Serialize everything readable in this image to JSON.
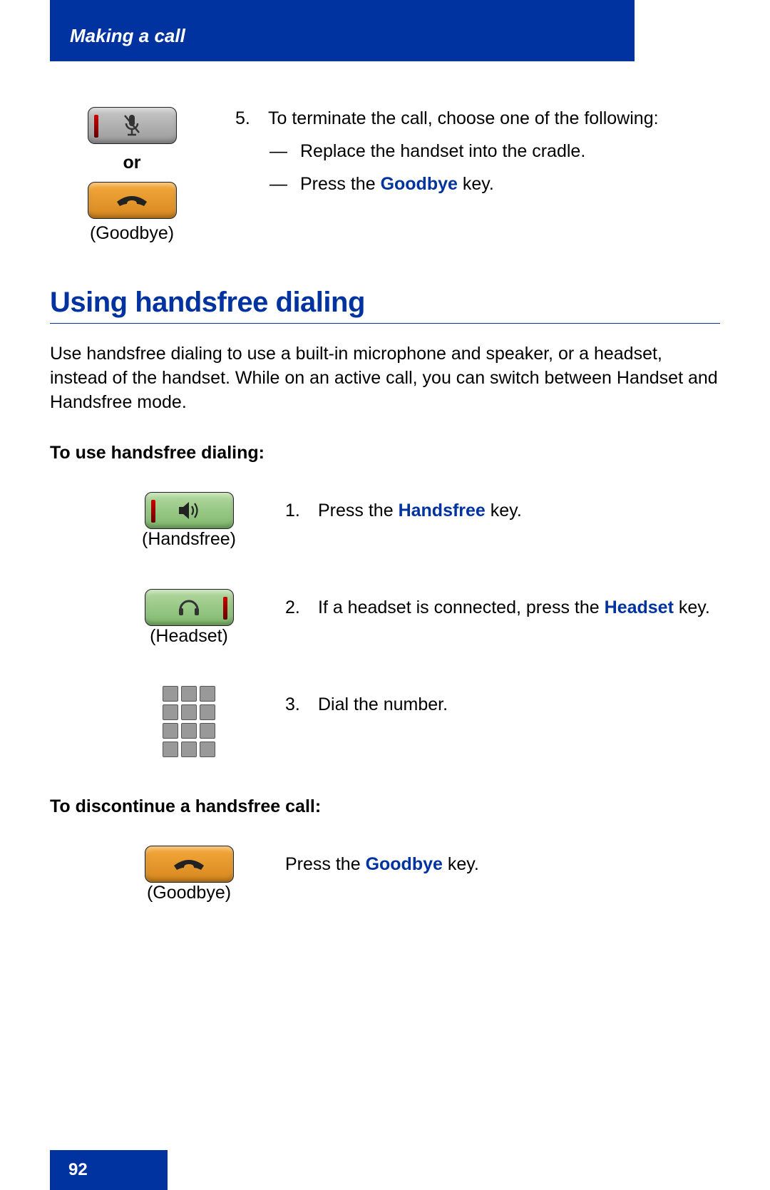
{
  "header": {
    "title": "Making a call"
  },
  "step5": {
    "iconTop": {
      "label": ""
    },
    "or": "or",
    "iconBottomLabel": "(Goodbye)",
    "number": "5.",
    "lead": "To terminate the call, choose one of the following:",
    "bullets": {
      "b1_pre": "Replace the handset into the cradle.",
      "b2_pre": "Press the ",
      "b2_key": "Goodbye",
      "b2_post": " key."
    }
  },
  "section": {
    "heading": "Using handsfree dialing",
    "intro": "Use handsfree dialing to use a built-in microphone and speaker, or a headset, instead of the handset. While on an active call, you can switch between Handset and Handsfree mode."
  },
  "sub1": "To use handsfree dialing:",
  "steps": {
    "s1": {
      "iconLabel": "(Handsfree)",
      "num": "1.",
      "pre": "Press the ",
      "key": "Handsfree",
      "post": " key."
    },
    "s2": {
      "iconLabel": "(Headset)",
      "num": "2.",
      "pre": "If a headset is connected, press the ",
      "key": "Headset",
      "post": " key."
    },
    "s3": {
      "num": "3.",
      "text": "Dial the number."
    }
  },
  "sub2": "To discontinue a handsfree call:",
  "discontinue": {
    "iconLabel": "(Goodbye)",
    "pre": "Press the ",
    "key": "Goodbye",
    "post": " key."
  },
  "footer": {
    "page": "92"
  }
}
